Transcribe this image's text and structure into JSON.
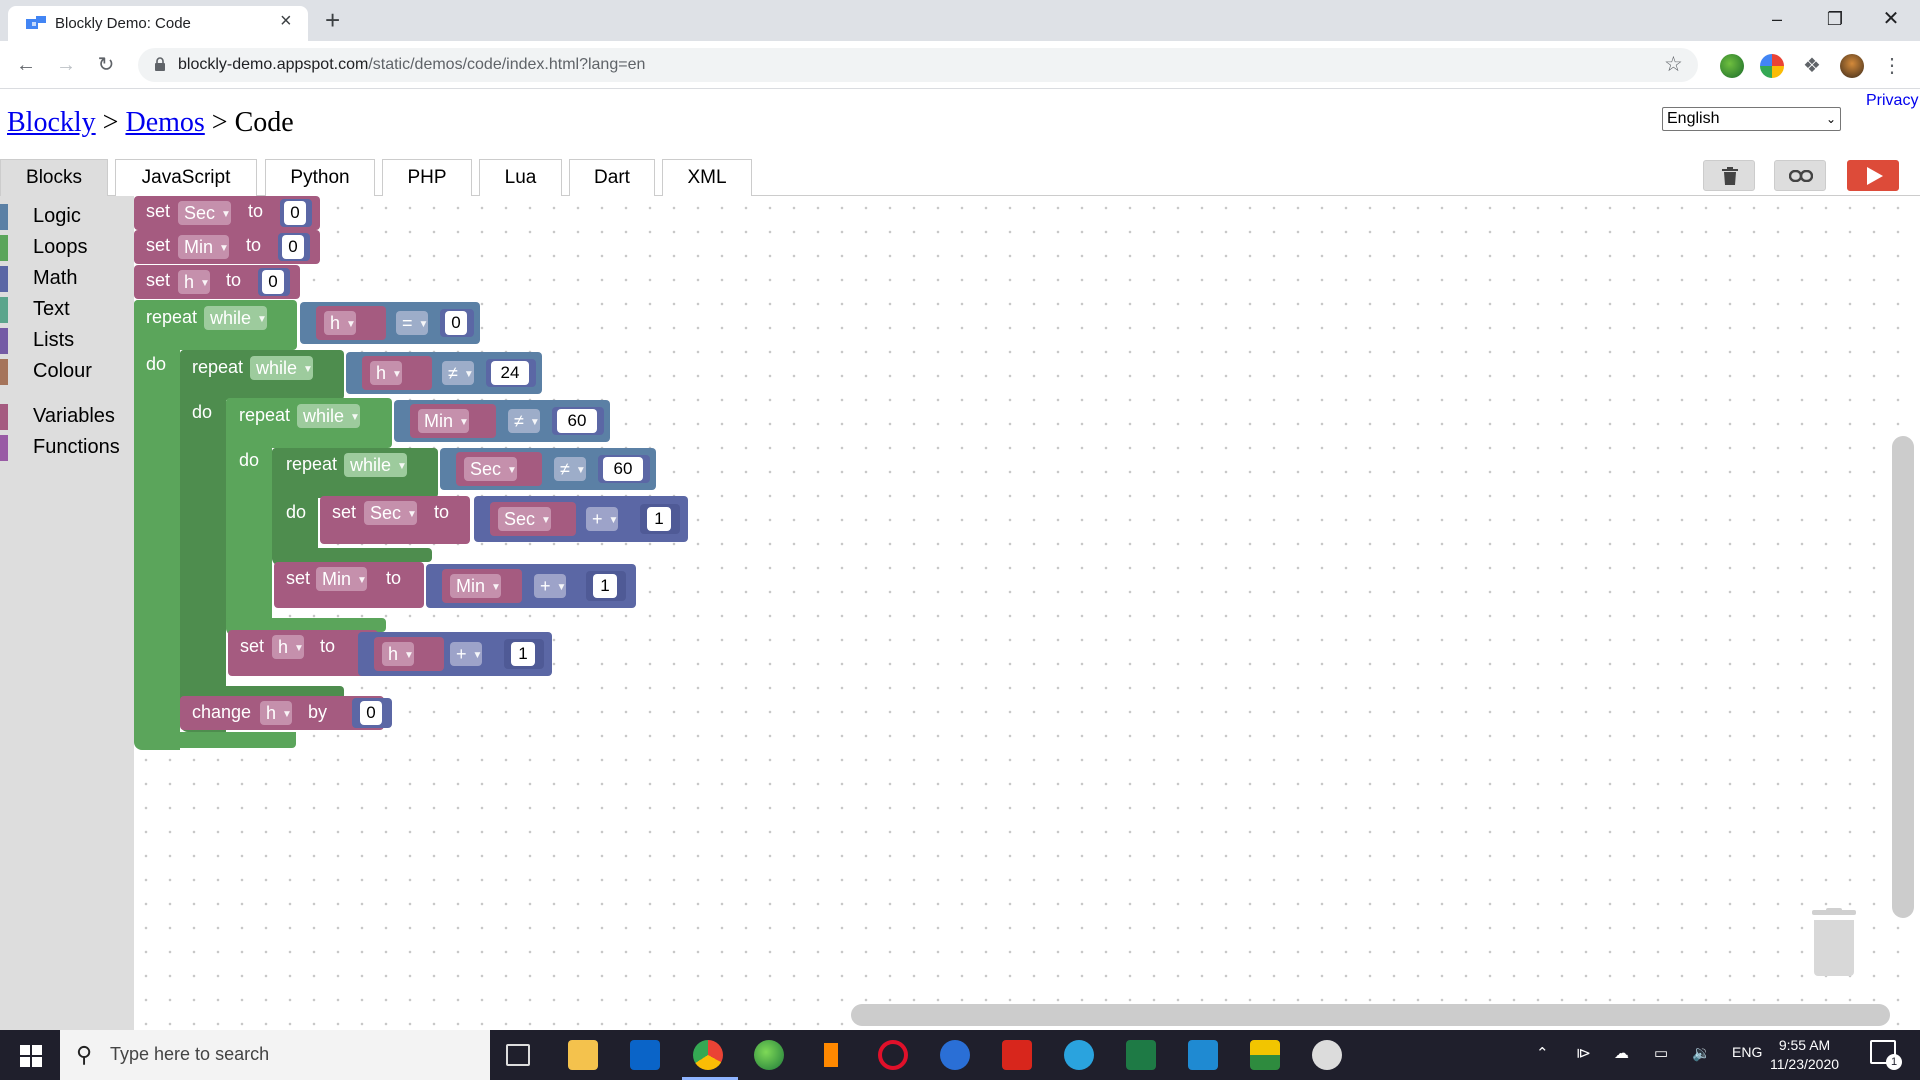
{
  "browser": {
    "tab_title": "Blockly Demo: Code",
    "url_host": "blockly-demo.appspot.com",
    "url_path": "/static/demos/code/index.html?lang=en"
  },
  "page": {
    "breadcrumb": [
      "Blockly",
      "Demos",
      "Code"
    ],
    "breadcrumb_sep": ">",
    "language": "English",
    "privacy_link": "Privacy"
  },
  "code_tabs": [
    "Blocks",
    "JavaScript",
    "Python",
    "PHP",
    "Lua",
    "Dart",
    "XML"
  ],
  "active_tab": "Blocks",
  "toolbox": {
    "categories": [
      {
        "label": "Logic",
        "color": "#5b80a5"
      },
      {
        "label": "Loops",
        "color": "#5ba55b"
      },
      {
        "label": "Math",
        "color": "#5b67a5"
      },
      {
        "label": "Text",
        "color": "#5ba58c"
      },
      {
        "label": "Lists",
        "color": "#745ba5"
      },
      {
        "label": "Colour",
        "color": "#a5745b"
      },
      {
        "label": "Variables",
        "color": "#a55b80"
      },
      {
        "label": "Functions",
        "color": "#995ba5"
      }
    ]
  },
  "blocks": {
    "set": "set",
    "to": "to",
    "repeat": "repeat",
    "while": "while",
    "do": "do",
    "change": "change",
    "by": "by",
    "var_sec": "Sec",
    "var_min": "Min",
    "var_h": "h",
    "op_eq": "=",
    "op_neq": "≠",
    "op_plus": "+",
    "n0": "0",
    "n1": "1",
    "n24": "24",
    "n60": "60"
  },
  "taskbar": {
    "search_placeholder": "Type here to search",
    "lang": "ENG",
    "time": "9:55 AM",
    "date": "11/23/2020",
    "notifications": "1"
  },
  "colors": {
    "variables": "#a55b80",
    "loops": "#5ba55b",
    "logic": "#5b80a5",
    "math": "#5b67a5",
    "run_button": "#dd4b39",
    "link": "#0000ee"
  }
}
